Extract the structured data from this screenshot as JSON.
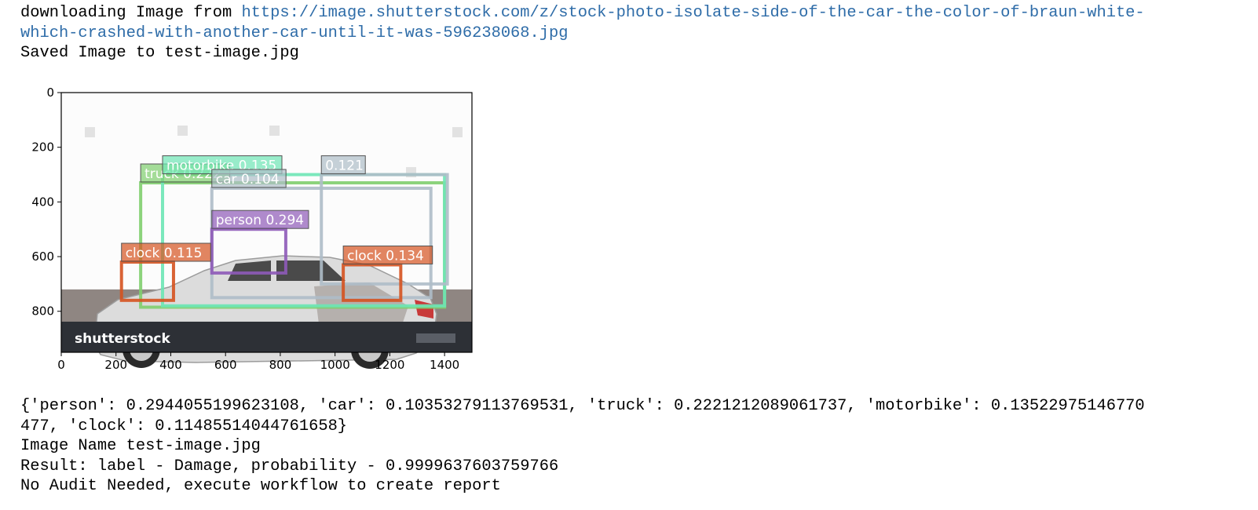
{
  "output": {
    "download_prefix": "downloading Image from ",
    "download_url_line1": "https://image.shutterstock.com/z/stock-photo-isolate-side-of-the-car-the-color-of-braun-white-",
    "download_url_line2": "which-crashed-with-another-car-until-it-was-596238068.jpg",
    "saved_line": "Saved Image to test-image.jpg",
    "dict_line1": "{'person': 0.2944055199623108, 'car': 0.10353279113769531, 'truck': 0.2221212089061737, 'motorbike': 0.13522975146770",
    "dict_line2": "477, 'clock': 0.11485514044761658}",
    "image_name_line": "Image Name test-image.jpg",
    "result_line": "Result: label - Damage, probability - 0.9999637603759766",
    "audit_line": "No Audit Needed, execute workflow to create report"
  },
  "plot": {
    "watermark": "shutterstock",
    "colors": {
      "truck": "#7fce6e",
      "motorbike": "#6de6b5",
      "car": "#aebdc8",
      "person": "#8e5ab8",
      "clock": "#d5521f"
    }
  },
  "chart_data": {
    "type": "image-with-detections",
    "xlim": [
      0,
      1500
    ],
    "ylim": [
      950,
      0
    ],
    "x_ticks": [
      "0",
      "200",
      "400",
      "600",
      "800",
      "1000",
      "1200",
      "1400"
    ],
    "y_ticks": [
      "0",
      "200",
      "400",
      "600",
      "800"
    ],
    "detections": [
      {
        "label": "truck 0.222",
        "cls": "truck",
        "x1": 290,
        "y1": 330,
        "x2": 1400,
        "y2": 785
      },
      {
        "label": "motorbike 0.135",
        "cls": "motorbike",
        "x1": 370,
        "y1": 300,
        "x2": 1400,
        "y2": 780
      },
      {
        "label": "car 0.104",
        "cls": "car",
        "x1": 550,
        "y1": 350,
        "x2": 1350,
        "y2": 750
      },
      {
        "label": "0.121",
        "cls": "car",
        "x1": 950,
        "y1": 300,
        "x2": 1410,
        "y2": 700
      },
      {
        "label": "person 0.294",
        "cls": "person",
        "x1": 550,
        "y1": 500,
        "x2": 820,
        "y2": 660
      },
      {
        "label": "clock 0.115",
        "cls": "clock",
        "x1": 220,
        "y1": 620,
        "x2": 410,
        "y2": 760
      },
      {
        "label": "clock 0.134",
        "cls": "clock",
        "x1": 1030,
        "y1": 630,
        "x2": 1240,
        "y2": 760
      }
    ]
  }
}
